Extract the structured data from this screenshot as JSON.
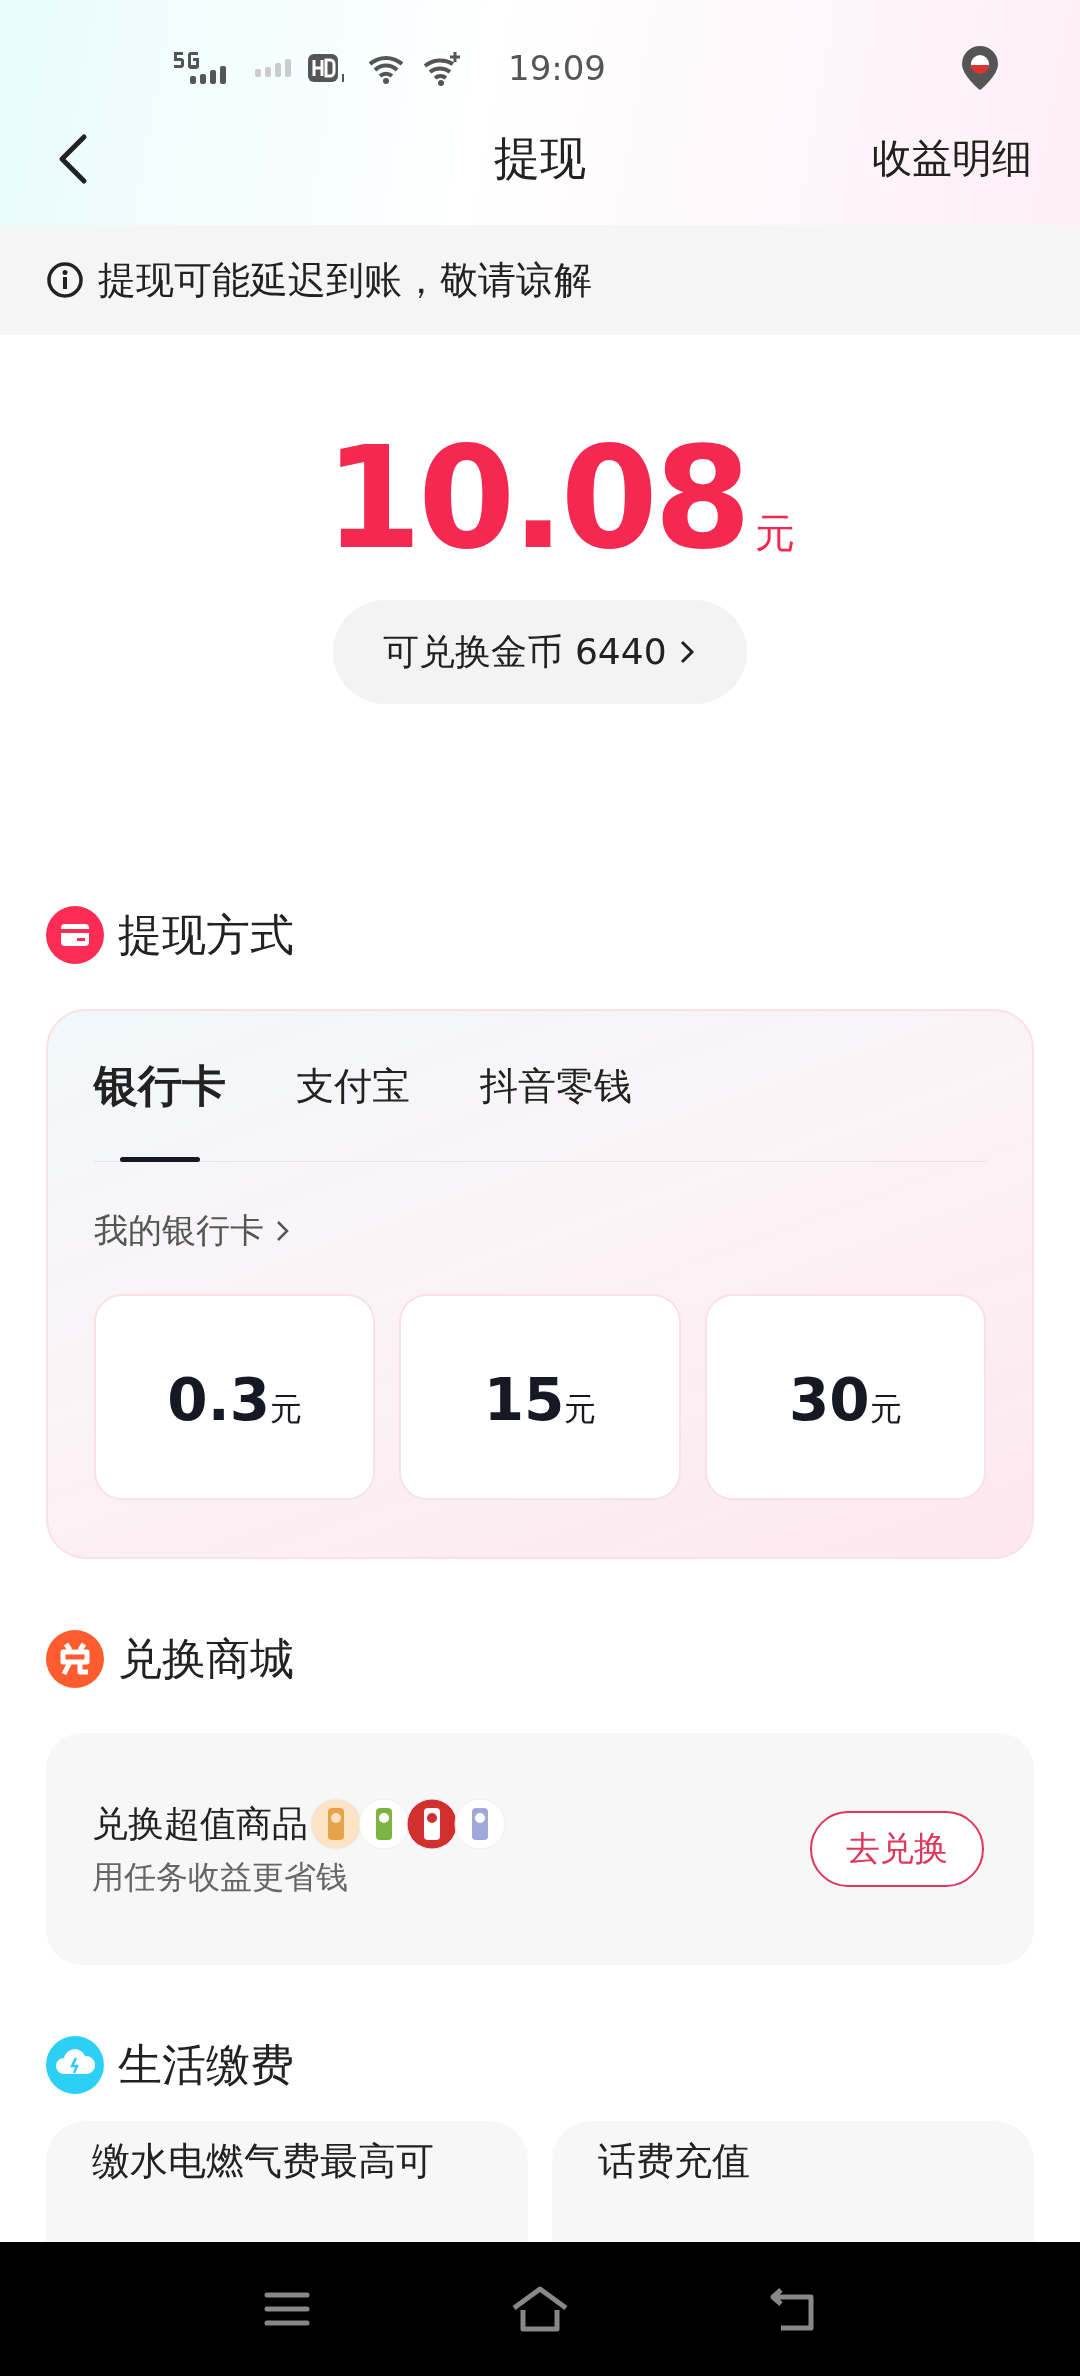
{
  "status_bar": {
    "time": "19:09"
  },
  "nav": {
    "title": "提现",
    "action": "收益明细"
  },
  "notice": {
    "text": "提现可能延迟到账，敬请谅解"
  },
  "balance": {
    "amount": "10.08",
    "unit": "元",
    "coins_label": "可兑换金币 6440"
  },
  "sections": [
    {
      "kind": "withdraw",
      "title": "提现方式"
    },
    {
      "kind": "exchange",
      "title": "兑换商城"
    },
    {
      "kind": "bills",
      "title": "生活缴费"
    }
  ],
  "withdraw": {
    "tabs": [
      {
        "label": "银行卡",
        "selected": true
      },
      {
        "label": "支付宝",
        "selected": false
      },
      {
        "label": "抖音零钱",
        "selected": false
      }
    ],
    "link": "我的银行卡",
    "options": [
      {
        "value": "0.3",
        "unit": "元"
      },
      {
        "value": "15",
        "unit": "元"
      },
      {
        "value": "30",
        "unit": "元"
      }
    ]
  },
  "exchange": {
    "title": "兑换超值商品",
    "subtitle": "用任务收益更省钱",
    "button": "去兑换"
  },
  "bills": [
    {
      "title": "缴水电燃气费最高可"
    },
    {
      "title": "话费充值"
    }
  ]
}
